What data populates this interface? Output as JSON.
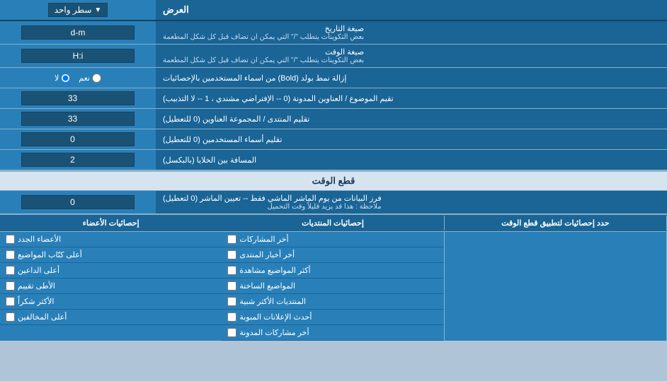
{
  "page": {
    "title": "العرض",
    "sections": {
      "display": {
        "label": "العرض"
      },
      "singleLine": {
        "label": "سطر واحد",
        "dropdown_value": "سطر واحد"
      },
      "dateFormat": {
        "row_label": "صيغة التاريخ",
        "row_sublabel": "بعض التكوينات يتطلب \"/\" التي يمكن ان تضاف قبل كل شكل المطعمة",
        "input_value": "d-m"
      },
      "timeFormat": {
        "row_label": "صيغة الوقت",
        "row_sublabel": "بعض التكوينات يتطلب \"/\" التي يمكن ان تضاف قبل كل شكل المطعمة",
        "input_value": "H:i"
      },
      "boldRemove": {
        "row_label": "إزالة نمط بولد (Bold) من اسماء المستخدمين بالإحصائيات",
        "radio_yes": "نعم",
        "radio_no": "لا",
        "selected": "no"
      },
      "topicOrder": {
        "row_label": "تقيم الموضوع / العناوين المدونة (0 -- الإفتراضي مشندي ، 1 -- لا التذبيب)",
        "input_value": "33"
      },
      "forumOrder": {
        "row_label": "تقليم المنتدى / المجموعة العناوين (0 للتعطيل)",
        "input_value": "33"
      },
      "userNames": {
        "row_label": "تقليم أسماء المستخدمين (0 للتعطيل)",
        "input_value": "0"
      },
      "cellSpacing": {
        "row_label": "المسافة بين الخلايا (بالبكسل)",
        "input_value": "2"
      },
      "timeCutoff": {
        "header": "قطع الوقت",
        "row_label_main": "فرز البيانات من يوم الماشر الماشي فقط -- تعيين الماشر (0 لتعطيل)",
        "row_label_note": "ملاحظة : هذا قد يزيد قليلاً وقت التحميل",
        "input_value": "0",
        "limit_label": "حدد إحصائيات لتطبيق قطع الوقت"
      }
    },
    "stats": {
      "header_posts": "إحصائيات المنتديات",
      "header_members": "إحصائيات الأعضاء",
      "posts_items": [
        "أخر المشاركات",
        "أخر أخبار المنتدى",
        "أكثر المواضيع مشاهدة",
        "المواضيع الساخنة",
        "المنتديات الأكثر شبية",
        "أحدث الإعلانات المبوبة",
        "أخر مشاركات المدونة"
      ],
      "members_items": [
        "الأعضاء الجدد",
        "أعلى كتّاب المواضيع",
        "أعلى الداعين",
        "الأطى تقييم",
        "الأكثر شكراً",
        "أعلى المخالفين"
      ]
    }
  }
}
